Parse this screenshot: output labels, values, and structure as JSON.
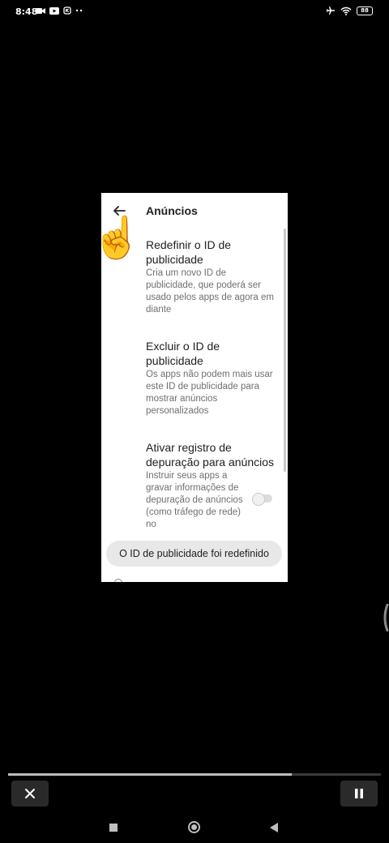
{
  "status_bar": {
    "time": "8:48",
    "battery": "88",
    "left_icons": [
      "video-camera-icon",
      "youtube-icon",
      "kakao-icon",
      "more-dots-icon"
    ],
    "right_icons": [
      "airplane-mode-icon",
      "wifi-icon",
      "battery-icon"
    ]
  },
  "screen": {
    "app_bar": {
      "title": "Anúncios"
    },
    "items": [
      {
        "title": "Redefinir o ID de publicidade",
        "description": "Cria um novo ID de publicidade, que poderá ser usado pelos apps de agora em diante"
      },
      {
        "title": "Excluir o ID de publicidade",
        "description": "Os apps não podem mais usar este ID de publicidade para mostrar anúncios personalizados"
      },
      {
        "title": "Ativar registro de depuração para anúncios",
        "description": "Instruir seus apps a gravar informações de depuração de anúncios (como tráfego de rede) no"
      }
    ],
    "debug_toggle_on": false,
    "toast": "O ID de publicidade foi redefinido"
  },
  "player": {
    "progress": 0.76,
    "close_icon": "close-icon",
    "pause_icon": "pause-icon"
  },
  "navigation": {
    "icons": [
      "recents-icon",
      "home-icon",
      "back-icon"
    ]
  },
  "colors": {
    "background": "#000000",
    "panel": "#ffffff",
    "secondary_text": "#6f6f6f",
    "toast_bg": "#e8e8e8"
  }
}
